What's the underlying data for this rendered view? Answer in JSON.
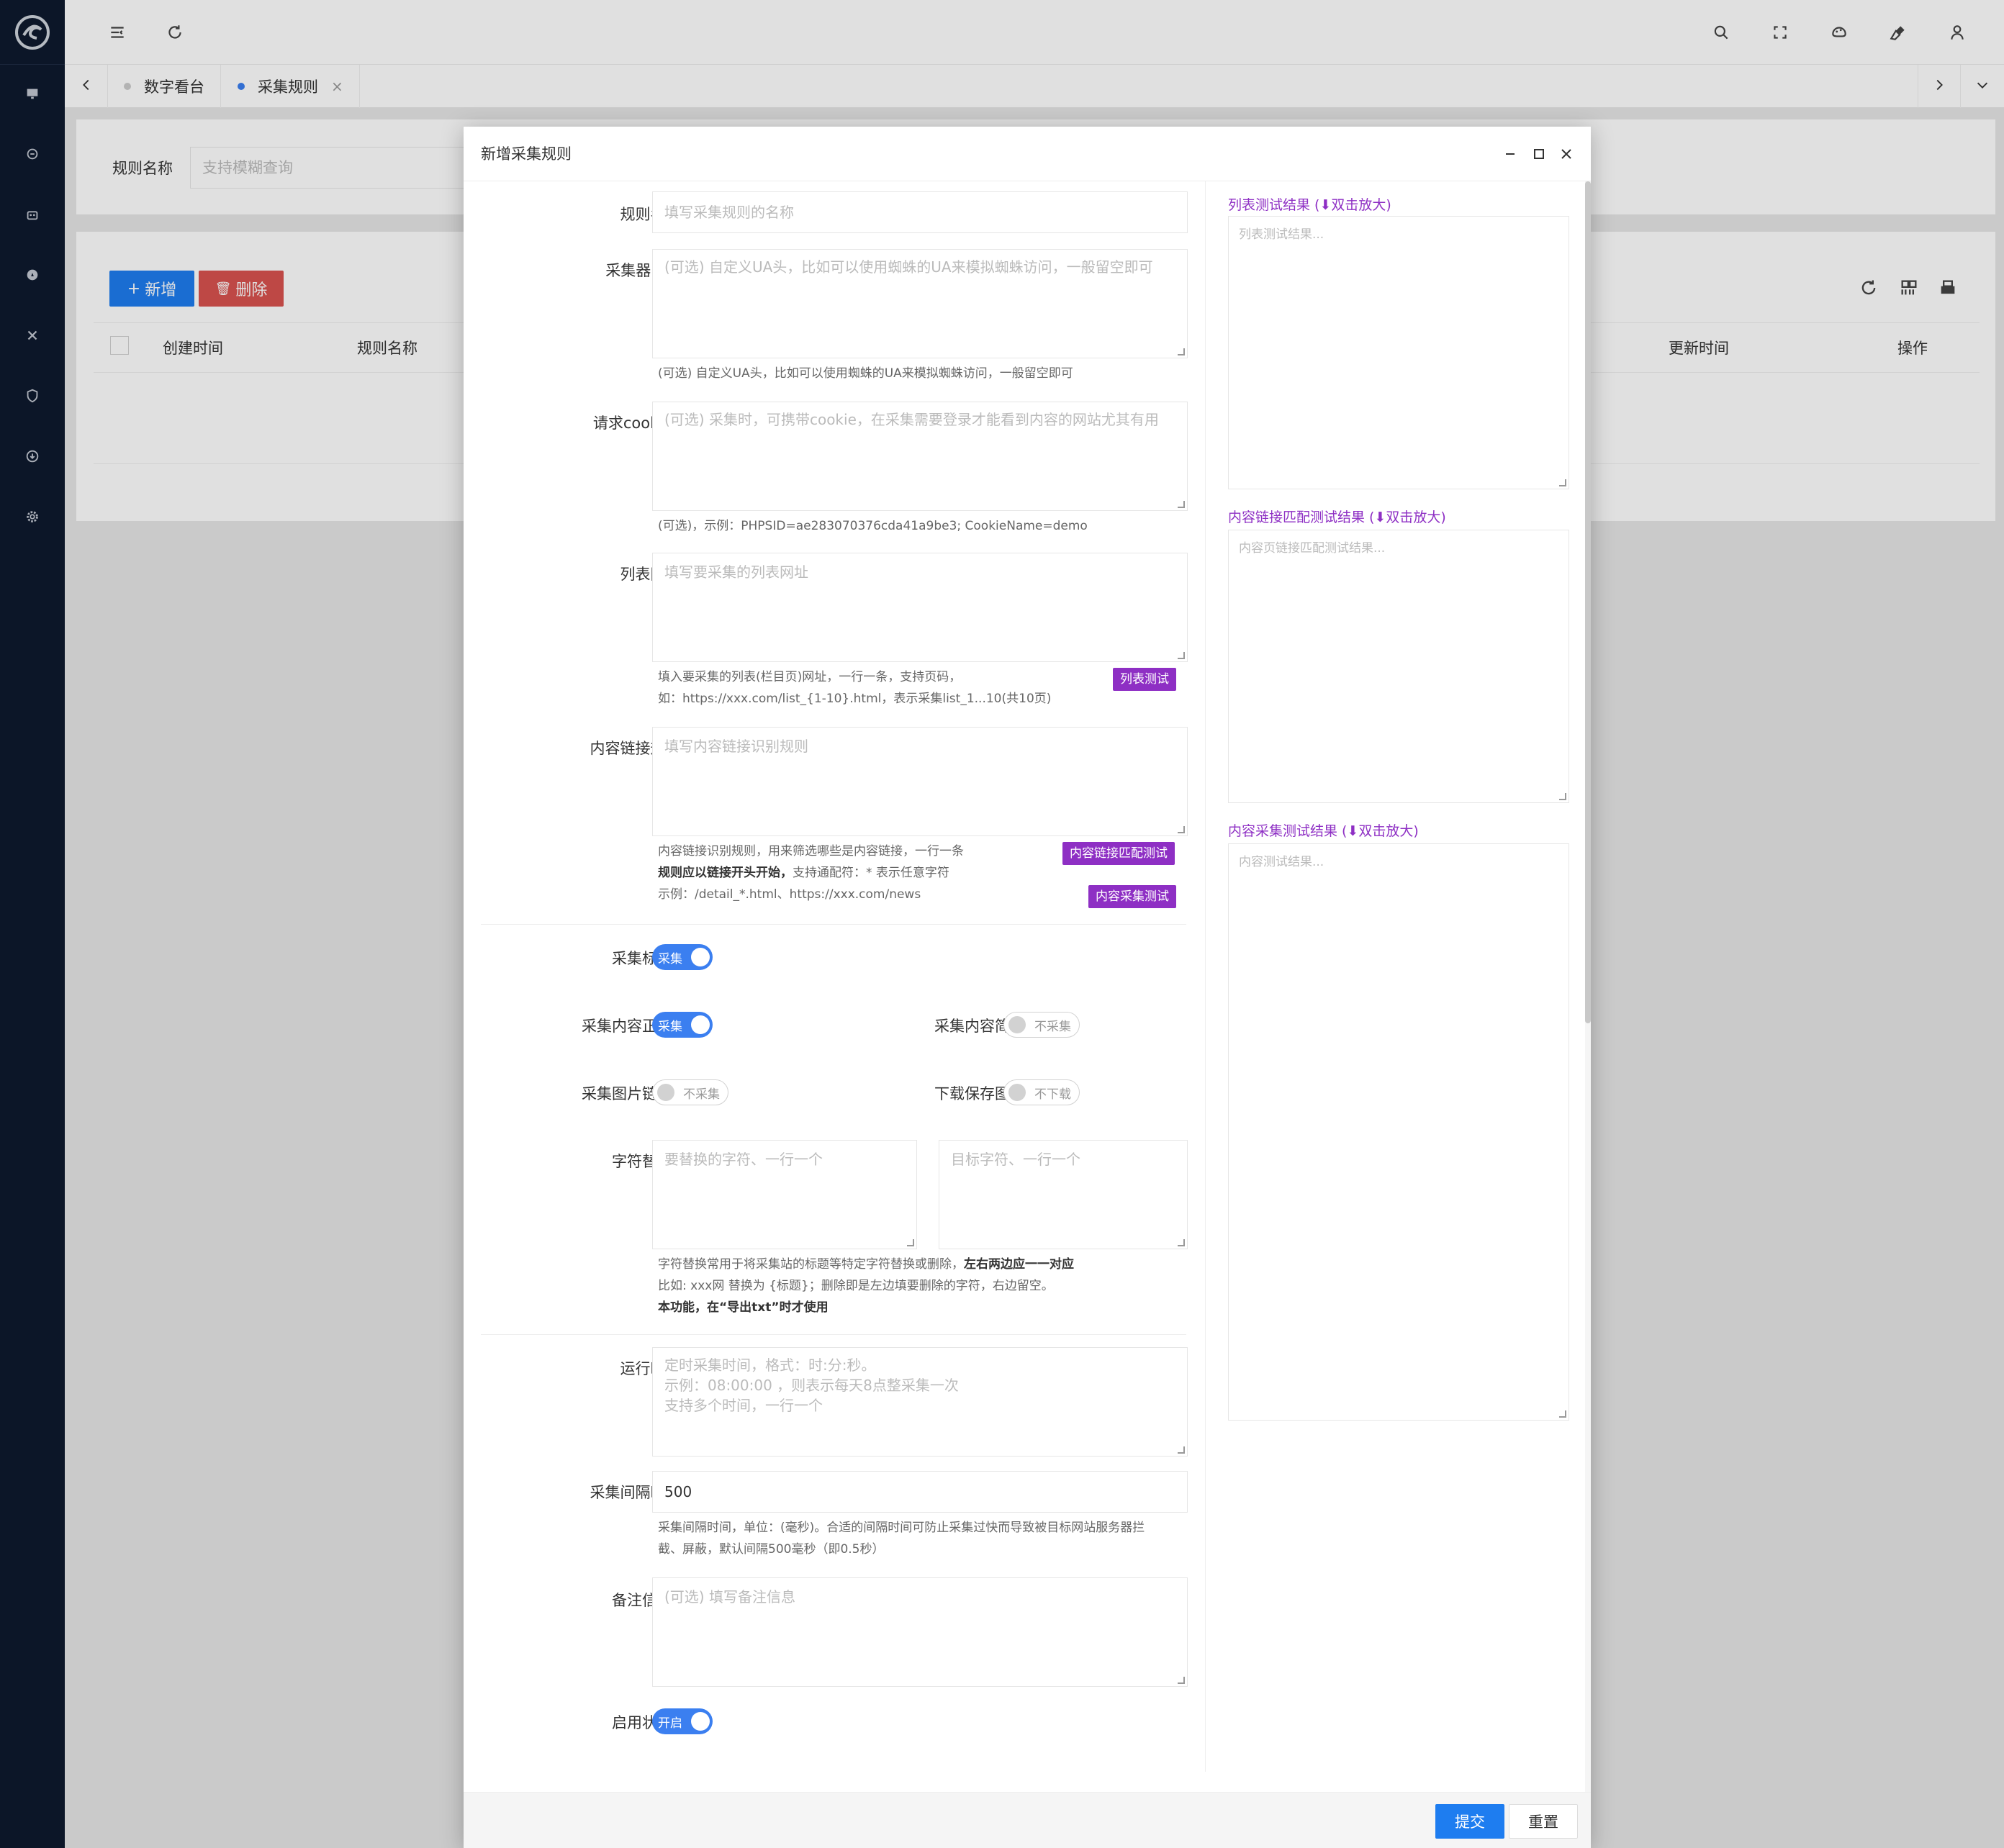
{
  "header": {
    "icons": [
      "menu-fold-icon",
      "refresh-icon",
      "search-icon",
      "fullscreen-icon",
      "theme-icon",
      "clear-icon",
      "user-icon"
    ]
  },
  "tabs": [
    {
      "label": "数字看台",
      "active": false
    },
    {
      "label": "采集规则",
      "active": true
    }
  ],
  "search": {
    "label": "规则名称",
    "placeholder": "支持模糊查询"
  },
  "toolbar": {
    "add": "新增",
    "delete": "删除"
  },
  "table": {
    "headers": [
      "创建时间",
      "规则名称",
      "更新时间",
      "操作"
    ]
  },
  "modal": {
    "title": "新增采集规则",
    "fields": {
      "rule_name": {
        "label": "规则名称",
        "placeholder": "填写采集规则的名称"
      },
      "ua": {
        "label": "采集器UA",
        "placeholder": "(可选) 自定义UA头，比如可以使用蜘蛛的UA来模拟蜘蛛访问，一般留空即可",
        "hint": "(可选) 自定义UA头，比如可以使用蜘蛛的UA来模拟蜘蛛访问，一般留空即可"
      },
      "cookie": {
        "label": "请求cookie",
        "placeholder": "(可选) 采集时，可携带cookie，在采集需要登录才能看到内容的网站尤其有用",
        "hint": "(可选)，示例：PHPSID=ae283070376cda41a9be3; CookieName=demo"
      },
      "list_url": {
        "label": "列表网址",
        "placeholder": "填写要采集的列表网址",
        "hint1": "填入要采集的列表(栏目页)网址，一行一条，支持页码，",
        "hint2": "如：https://xxx.com/list_{1-10}.html，表示采集list_1...10(共10页)",
        "btn": "列表测试"
      },
      "content_rule": {
        "label": "内容链接规则",
        "placeholder": "填写内容链接识别规则",
        "hint1": "内容链接识别规则，用来筛选哪些是内容链接，一行一条",
        "hint2_bold": "规则应以链接开头开始，",
        "hint2_rest": "支持通配符：* 表示任意字符",
        "hint3": "示例：/detail_*.html、https://xxx.com/news",
        "btn1": "内容链接匹配测试",
        "btn2": "内容采集测试"
      },
      "collect_title": {
        "label": "采集标题",
        "switch": "采集"
      },
      "collect_body": {
        "label": "采集内容正文",
        "switch": "采集"
      },
      "collect_summary": {
        "label": "采集内容简介",
        "switch": "不采集"
      },
      "collect_img": {
        "label": "采集图片链接",
        "switch": "不采集"
      },
      "download_img": {
        "label": "下载保存图片",
        "switch": "不下载"
      },
      "replace": {
        "label": "字符替换",
        "placeholder_left": "要替换的字符、一行一个",
        "placeholder_right": "目标字符、一行一个",
        "hint1": "字符替换常用于将采集站的标题等特定字符替换或删除，",
        "hint1_bold": "左右两边应一一对应",
        "hint2": "比如: xxx网 替换为 {标题}；删除即是左边填要删除的字符，右边留空。",
        "hint3_bold": "本功能，在“导出txt”时才使用"
      },
      "run_time": {
        "label": "运行时间",
        "ph1": "定时采集时间，格式：时:分:秒。",
        "ph2": "示例：08:00:00 ，则表示每天8点整采集一次",
        "ph3": "支持多个时间，一行一个"
      },
      "interval": {
        "label": "采集间隔时间",
        "value": "500",
        "hint1": "采集间隔时间，单位：(毫秒)。合适的间隔时间可防止采集过快而导致被目标网站服务器拦",
        "hint2": "截、屏蔽，默认间隔500毫秒（即0.5秒）"
      },
      "remark": {
        "label": "备注信息",
        "placeholder": "(可选) 填写备注信息"
      },
      "status": {
        "label": "启用状态",
        "switch": "开启"
      }
    },
    "results": {
      "list": {
        "label": "列表测试结果 (⬇双击放大)",
        "placeholder": "列表测试结果..."
      },
      "link": {
        "label": "内容链接匹配测试结果 (⬇双击放大)",
        "placeholder": "内容页链接匹配测试结果..."
      },
      "content": {
        "label": "内容采集测试结果 (⬇双击放大)",
        "placeholder": "内容测试结果..."
      }
    },
    "footer": {
      "submit": "提交",
      "reset": "重置"
    }
  }
}
